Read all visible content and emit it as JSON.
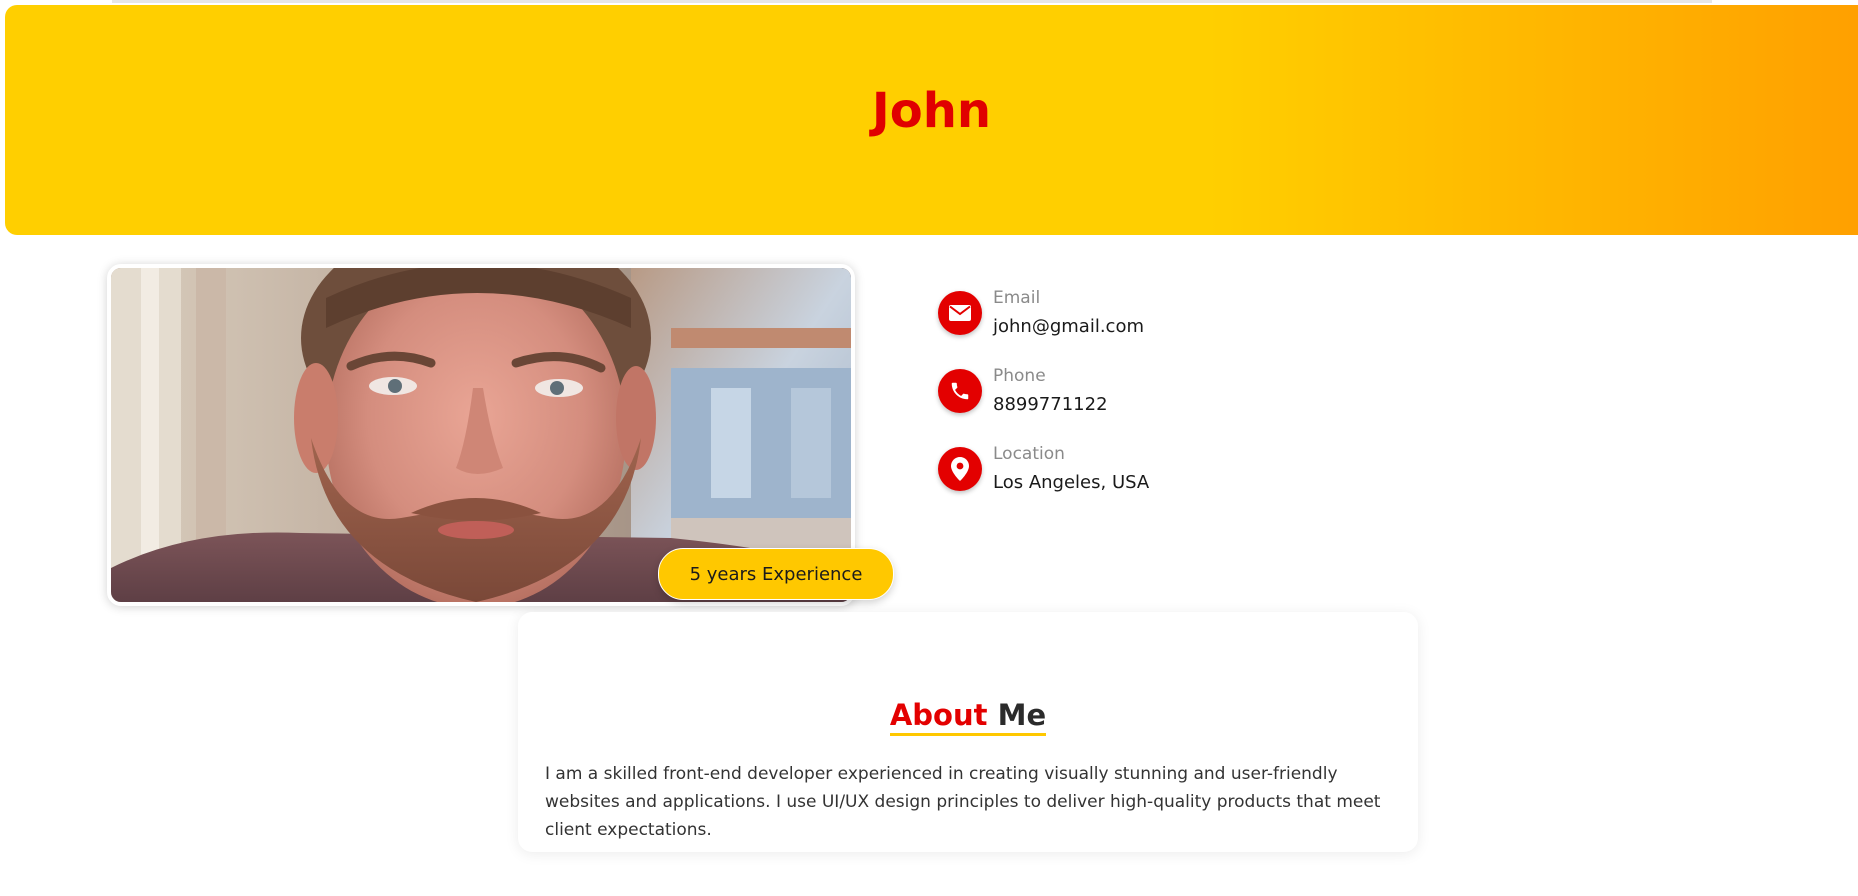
{
  "header": {
    "name": "John"
  },
  "profile": {
    "experience_badge": "5 years Experience"
  },
  "contacts": [
    {
      "label": "Email",
      "value": "john@gmail.com",
      "icon": "envelope-icon"
    },
    {
      "label": "Phone",
      "value": "8899771122",
      "icon": "phone-icon"
    },
    {
      "label": "Location",
      "value": "Los Angeles, USA",
      "icon": "map-pin-icon"
    }
  ],
  "about": {
    "title_part1": "About",
    "title_part2": "Me",
    "text": "I am a skilled front-end developer experienced in creating visually stunning and user-friendly websites and applications. I use UI/UX design principles to deliver high-quality products that meet client expectations."
  },
  "colors": {
    "accent_red": "#e30000",
    "banner_yellow": "#ffcf00",
    "banner_orange": "#ffa000",
    "badge_yellow": "#ffc800"
  }
}
